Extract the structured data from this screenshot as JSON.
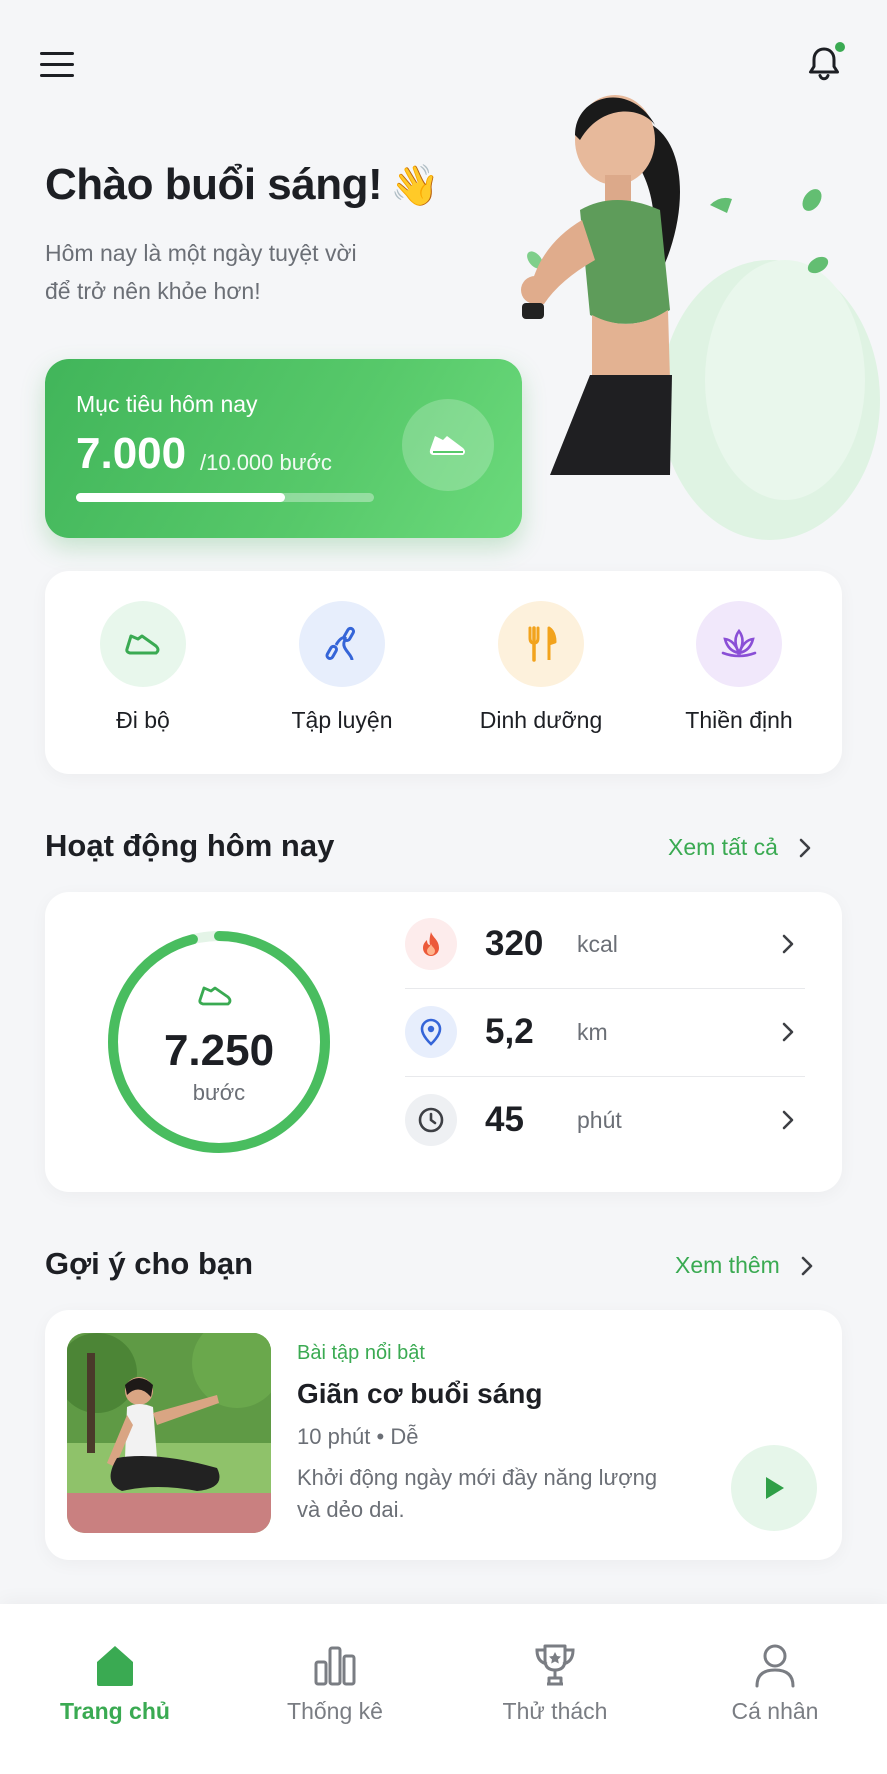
{
  "header": {
    "menu_icon": "menu-icon",
    "bell_icon": "bell-icon",
    "notification_dot_color": "#3aaa52"
  },
  "hero": {
    "greeting": "Chào buổi sáng!",
    "wave_emoji": "👋",
    "subtitle_line1": "Hôm nay là một ngày tuyệt vời",
    "subtitle_line2": "để trở nên khỏe hơn!"
  },
  "goal": {
    "label": "Mục tiêu hôm nay",
    "value": "7.000",
    "total": "/10.000 bước",
    "progress": 0.7,
    "icon": "shoe-icon"
  },
  "categories": [
    {
      "label": "Đi bộ",
      "icon": "shoe-icon",
      "bg": "#e8f7ec",
      "color": "#3aaa52"
    },
    {
      "label": "Tập luyện",
      "icon": "jump-rope-icon",
      "bg": "#e7eefc",
      "color": "#3565d8"
    },
    {
      "label": "Dinh dưỡng",
      "icon": "utensils-icon",
      "bg": "#fdf1dc",
      "color": "#f2a31d"
    },
    {
      "label": "Thiền định",
      "icon": "lotus-icon",
      "bg": "#f1e8fb",
      "color": "#8a4fd6"
    }
  ],
  "activity": {
    "title": "Hoạt động hôm nay",
    "link": "Xem tất cả",
    "steps": "7.250",
    "steps_unit": "bước",
    "ring_progress": 0.96,
    "stats": [
      {
        "value": "320",
        "unit": "kcal",
        "icon": "fire-icon",
        "bg": "#fdecec",
        "color": "#ec5a3a"
      },
      {
        "value": "5,2",
        "unit": "km",
        "icon": "location-pin-icon",
        "bg": "#e7eefc",
        "color": "#3565d8"
      },
      {
        "value": "45",
        "unit": "phút",
        "icon": "clock-icon",
        "bg": "#eef0f3",
        "color": "#3d3f44"
      }
    ]
  },
  "suggestions": {
    "title": "Gợi ý cho bạn",
    "link": "Xem thêm",
    "card": {
      "tag": "Bài tập nổi bật",
      "title": "Giãn cơ buổi sáng",
      "duration": "10 phút",
      "level": "Dễ",
      "desc_line1": "Khởi động ngày mới đầy năng lượng",
      "desc_line2": "và dẻo dai."
    }
  },
  "tabs": [
    {
      "label": "Trang chủ",
      "icon": "home-icon",
      "active": true
    },
    {
      "label": "Thống kê",
      "icon": "bar-chart-icon",
      "active": false
    },
    {
      "label": "Thử thách",
      "icon": "trophy-icon",
      "active": false
    },
    {
      "label": "Cá nhân",
      "icon": "user-icon",
      "active": false
    }
  ],
  "colors": {
    "accent": "#3aaa52",
    "background": "#f5f6f8"
  }
}
